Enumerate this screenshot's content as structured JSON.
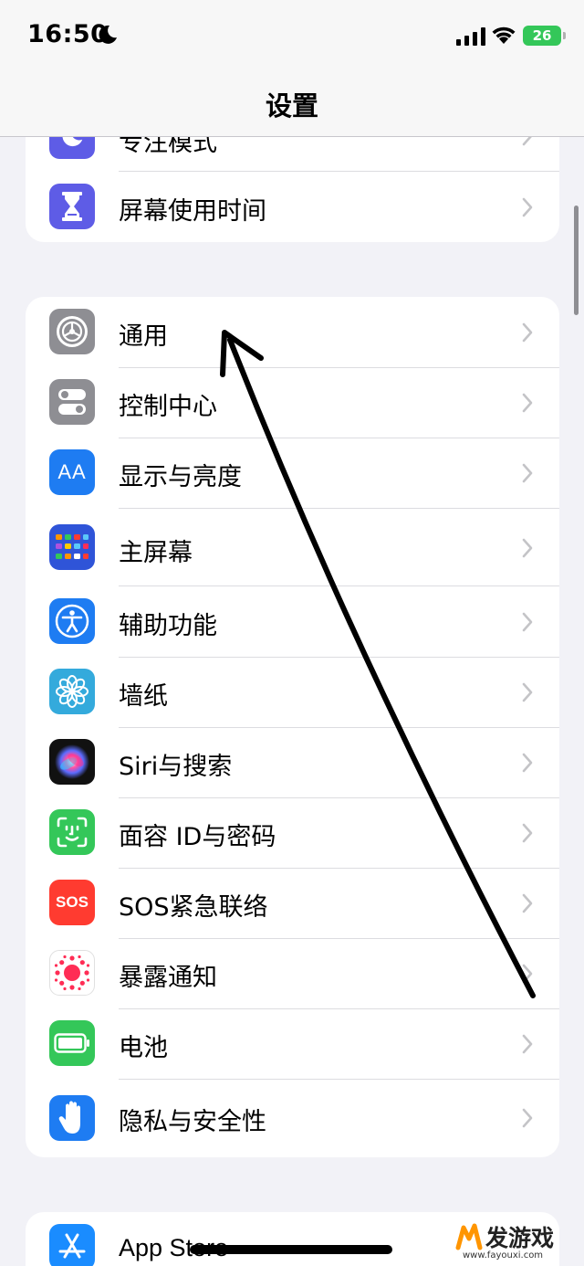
{
  "status_bar": {
    "time": "16:50",
    "battery": "26"
  },
  "nav": {
    "title": "设置"
  },
  "group_top": [
    {
      "label": "专注模式",
      "icon": "moon-icon",
      "color": "#5e5ce6"
    },
    {
      "label": "屏幕使用时间",
      "icon": "hourglass-icon",
      "color": "#5e5ce6"
    }
  ],
  "group_main": [
    {
      "label": "通用",
      "icon": "gear-icon",
      "color": "#8e8e93"
    },
    {
      "label": "控制中心",
      "icon": "toggles-icon",
      "color": "#8e8e93"
    },
    {
      "label": "显示与亮度",
      "icon": "text-size-icon",
      "color": "#1e7cf2"
    },
    {
      "label": "主屏幕",
      "icon": "home-grid-icon",
      "color": "#2f54d8"
    },
    {
      "label": "辅助功能",
      "icon": "accessibility-icon",
      "color": "#1e7cf2"
    },
    {
      "label": "墙纸",
      "icon": "flower-icon",
      "color": "#34aadc"
    },
    {
      "label": "Siri与搜索",
      "icon": "siri-icon",
      "color": "#111111"
    },
    {
      "label": "面容 ID与密码",
      "icon": "face-id-icon",
      "color": "#34c759"
    },
    {
      "label": "SOS紧急联络",
      "icon": "sos-icon",
      "color": "#ff3b30",
      "icon_text": "SOS"
    },
    {
      "label": "暴露通知",
      "icon": "exposure-icon",
      "color": "#ffffff"
    },
    {
      "label": "电池",
      "icon": "battery-icon",
      "color": "#34c759"
    },
    {
      "label": "隐私与安全性",
      "icon": "hand-icon",
      "color": "#1e7cf2"
    }
  ],
  "group_bottom": [
    {
      "label": "App Store",
      "icon": "app-store-icon",
      "color": "#1a8cff"
    }
  ],
  "watermark": {
    "text": "发游戏",
    "url": "www.fayouxi.com"
  }
}
